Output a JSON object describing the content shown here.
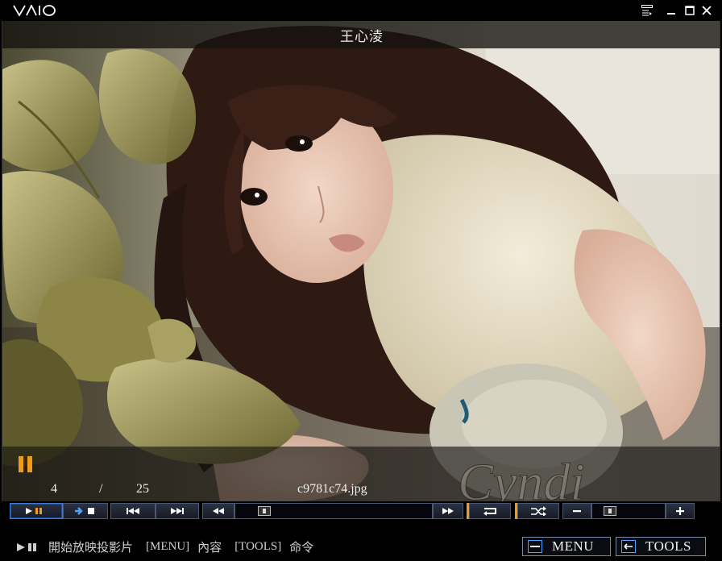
{
  "app": {
    "logo_text": "VAIO"
  },
  "window_controls": [
    {
      "name": "playlist-icon"
    },
    {
      "name": "minimize-icon"
    },
    {
      "name": "maximize-icon"
    },
    {
      "name": "close-icon"
    }
  ],
  "viewer": {
    "title": "王心淩",
    "state": "paused",
    "current_index": "4",
    "separator": "/",
    "total": "25",
    "filename": "c9781c74.jpg",
    "watermark": "Cyndi"
  },
  "controls": {
    "play_pause": "play-pause-icon",
    "stop": "stop-icon",
    "previous": "previous-track-icon",
    "next": "next-track-icon",
    "rewind": "rewind-icon",
    "fast_forward": "fast-forward-icon",
    "repeat": "repeat-icon",
    "shuffle": "shuffle-icon",
    "zoom_out": "minus-icon",
    "zoom_in": "plus-icon"
  },
  "hint": {
    "slideshow": "開始放映投影片",
    "menu_key": "[MENU]",
    "menu_desc": "內容",
    "tools_key": "[TOOLS]",
    "tools_desc": "命令"
  },
  "buttons": {
    "menu": "MENU",
    "tools": "TOOLS"
  },
  "colors": {
    "accent": "#f39a1a",
    "button_border": "#4a5874",
    "active_border": "#3d7bd8"
  }
}
